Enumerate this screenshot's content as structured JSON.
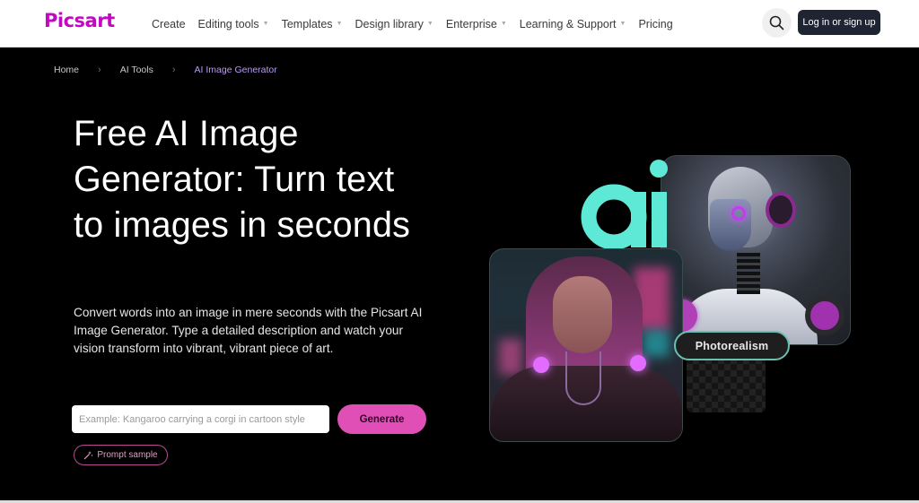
{
  "header": {
    "logo": "Picsart",
    "nav": [
      {
        "label": "Create",
        "has_dropdown": false
      },
      {
        "label": "Editing tools",
        "has_dropdown": true
      },
      {
        "label": "Templates",
        "has_dropdown": true
      },
      {
        "label": "Design library",
        "has_dropdown": true
      },
      {
        "label": "Enterprise",
        "has_dropdown": true
      },
      {
        "label": "Learning & Support",
        "has_dropdown": true
      },
      {
        "label": "Pricing",
        "has_dropdown": false
      }
    ],
    "search_icon": "search-icon",
    "login_label": "Log in or sign up"
  },
  "breadcrumb": {
    "items": [
      "Home",
      "AI Tools",
      "AI Image Generator"
    ],
    "separator_icon": "chevron-right-icon"
  },
  "hero": {
    "title": "Free AI Image Generator: Turn text to images in seconds",
    "description": "Convert words into an image in mere seconds with the Picsart AI Image Generator. Type a detailed description and watch your vision transform into vibrant, vibrant piece of art.",
    "prompt_placeholder": "Example: Kangaroo carrying a corgi in cartoon style",
    "prompt_value": "",
    "generate_label": "Generate",
    "prompt_sample_label": "Prompt sample",
    "prompt_sample_icon": "magic-wand-icon"
  },
  "artwork": {
    "ai_mark": "ai",
    "style_badge": "Photorealism",
    "colors": {
      "ai_mark": "#5ee8d6",
      "brand": "#c209c1",
      "generate": "#e04fb6"
    }
  }
}
